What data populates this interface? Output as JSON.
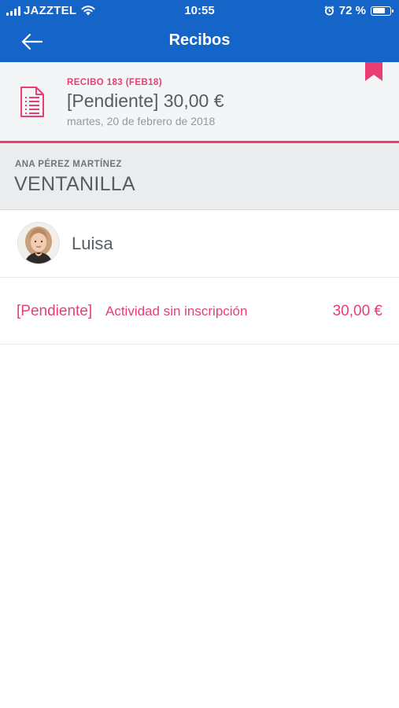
{
  "status_bar": {
    "carrier": "JAZZTEL",
    "time": "10:55",
    "battery": "72 %",
    "battery_level": 0.72
  },
  "nav": {
    "title": "Recibos",
    "back_icon": "back-arrow-icon"
  },
  "receipt": {
    "label": "RECIBO 183 (FEB18)",
    "title": "[Pendiente] 30,00 €",
    "date": "martes, 20 de febrero de 2018",
    "icon": "document-icon",
    "bookmark_icon": "bookmark-icon"
  },
  "client": {
    "name": "ANA PÉREZ MARTÍNEZ",
    "payment_type": "VENTANILLA"
  },
  "student": {
    "name": "Luisa"
  },
  "items": [
    {
      "status": "[Pendiente]",
      "description": "Actividad sin inscripción",
      "amount": "30,00 €"
    }
  ],
  "colors": {
    "header": "#1565c8",
    "accent": "#e83e73",
    "receipt_bg": "#f4f5f7",
    "client_bg": "#ebeced",
    "text": "#555d66"
  }
}
